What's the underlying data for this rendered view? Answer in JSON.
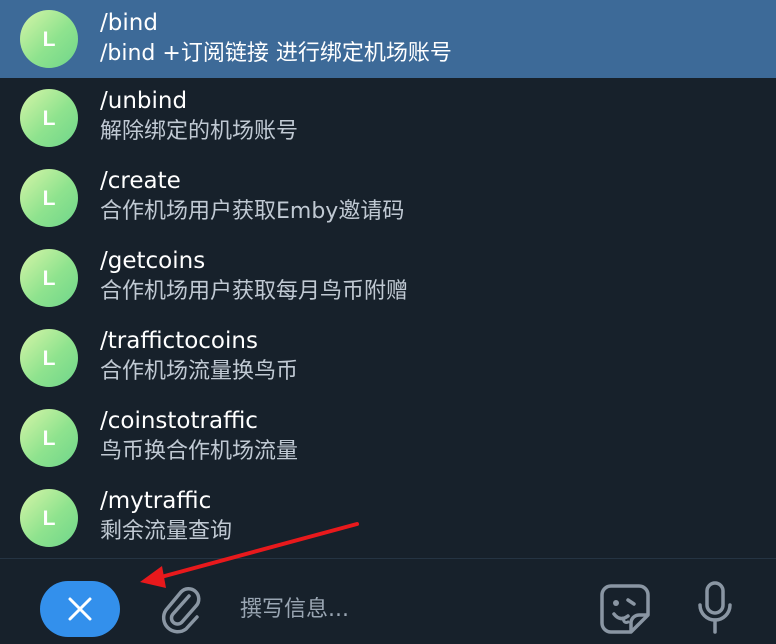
{
  "commands": [
    {
      "avatar_letter": "L",
      "name": "/bind",
      "description": "/bind +订阅链接 进行绑定机场账号",
      "selected": true
    },
    {
      "avatar_letter": "L",
      "name": "/unbind",
      "description": "解除绑定的机场账号",
      "selected": false
    },
    {
      "avatar_letter": "L",
      "name": "/create",
      "description": "合作机场用户获取Emby邀请码",
      "selected": false
    },
    {
      "avatar_letter": "L",
      "name": "/getcoins",
      "description": "合作机场用户获取每月鸟币附赠",
      "selected": false
    },
    {
      "avatar_letter": "L",
      "name": "/traffictocoins",
      "description": "合作机场流量换鸟币",
      "selected": false
    },
    {
      "avatar_letter": "L",
      "name": "/coinstotraffic",
      "description": "鸟币换合作机场流量",
      "selected": false
    },
    {
      "avatar_letter": "L",
      "name": "/mytraffic",
      "description": "剩余流量查询",
      "selected": false
    }
  ],
  "composer": {
    "placeholder": "撰写信息...",
    "value": "",
    "close_icon": "close-icon",
    "attach_icon": "paperclip-icon",
    "sticker_icon": "sticker-icon",
    "mic_icon": "microphone-icon"
  },
  "colors": {
    "background": "#17212b",
    "selected_row": "#3d6a98",
    "accent": "#3390ec",
    "annotation_arrow": "#e8191c"
  }
}
